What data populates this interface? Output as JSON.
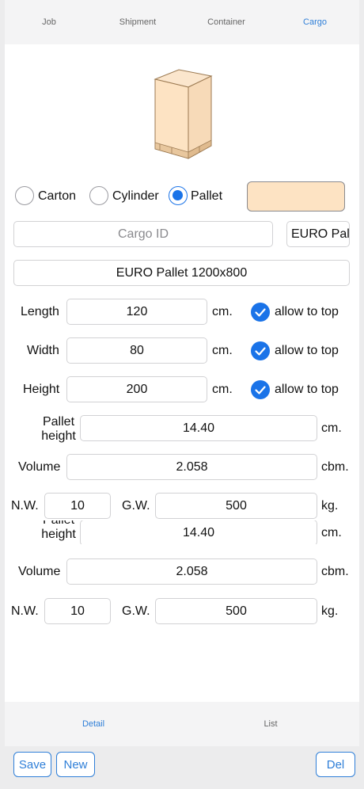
{
  "top_tabs": [
    {
      "label": "Job"
    },
    {
      "label": "Shipment"
    },
    {
      "label": "Container"
    },
    {
      "label": "Cargo"
    }
  ],
  "cargo_type": {
    "options": [
      "Carton",
      "Cylinder",
      "Pallet"
    ],
    "selected": "Pallet"
  },
  "color_swatch": "#fde3c3",
  "cargo_id": {
    "placeholder": "Cargo ID",
    "value": ""
  },
  "pallet_type_button": "EURO Pal",
  "pallet_name": "EURO Pallet 1200x800",
  "dimensions": {
    "length": {
      "label": "Length",
      "value": "120",
      "unit": "cm.",
      "allow": "allow to top"
    },
    "width": {
      "label": "Width",
      "value": "80",
      "unit": "cm.",
      "allow": "allow to top"
    },
    "height": {
      "label": "Height",
      "value": "200",
      "unit": "cm.",
      "allow": "allow to top"
    }
  },
  "pallet_height": {
    "label": "Pallet height",
    "value": "14.40",
    "unit": "cm."
  },
  "volume": {
    "label": "Volume",
    "value": "2.058",
    "unit": "cbm."
  },
  "weights": {
    "nw_label": "N.W.",
    "nw_value": "10",
    "gw_label": "G.W.",
    "gw_value": "500",
    "unit": "kg."
  },
  "duplicate": {
    "pallet_height": {
      "label": "Pallet height",
      "value": "14.40",
      "unit": "cm."
    },
    "volume": {
      "label": "Volume",
      "value": "2.058",
      "unit": "cbm."
    },
    "weights": {
      "nw_label": "N.W.",
      "nw_value": "10",
      "gw_label": "G.W.",
      "gw_value": "500",
      "unit": "kg."
    }
  },
  "bottom_tabs": [
    {
      "label": "Detail"
    },
    {
      "label": "List"
    }
  ],
  "actions": {
    "save": "Save",
    "new": "New",
    "delete": "Del"
  },
  "colors": {
    "accent": "#1a73e8",
    "box_fill": "#fde3c3",
    "box_stroke": "#b08a5a"
  }
}
